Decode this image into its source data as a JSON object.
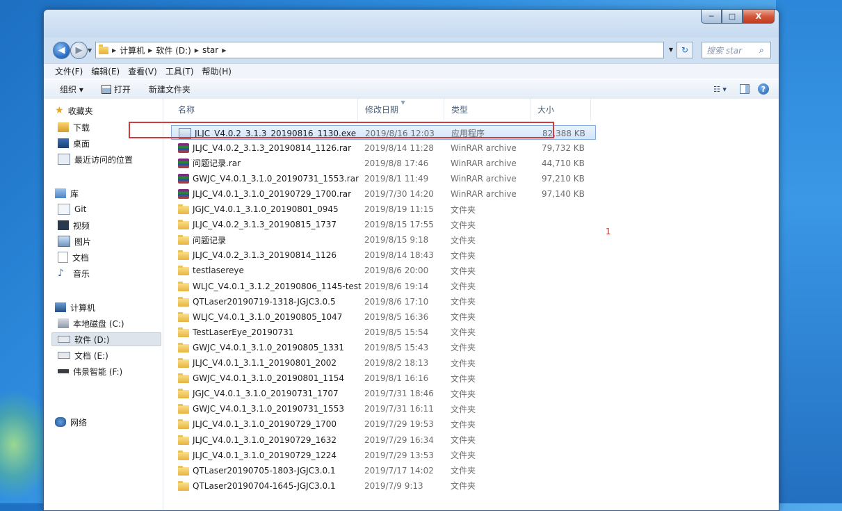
{
  "window": {
    "caption": {
      "minimize": "─",
      "maximize": "□",
      "close": "X"
    }
  },
  "address": {
    "back_icon": "back-arrow-icon",
    "forward_icon": "forward-arrow-icon",
    "crumbs": [
      "计算机",
      "软件 (D:)",
      "star"
    ],
    "search_placeholder": "搜索 star"
  },
  "menu": [
    "文件(F)",
    "编辑(E)",
    "查看(V)",
    "工具(T)",
    "帮助(H)"
  ],
  "toolbar": {
    "organize": "组织 ▾",
    "open": "打开",
    "new_folder": "新建文件夹"
  },
  "sidebar": {
    "favorites": {
      "header": "收藏夹",
      "items": [
        "下载",
        "桌面",
        "最近访问的位置"
      ]
    },
    "libraries": {
      "header": "库",
      "items": [
        "Git",
        "视频",
        "图片",
        "文档",
        "音乐"
      ]
    },
    "computer": {
      "header": "计算机",
      "items": [
        "本地磁盘 (C:)",
        "软件 (D:)",
        "文档 (E:)",
        "伟景智能 (F:)"
      ],
      "selected": "软件 (D:)"
    },
    "network": {
      "header": "网络"
    }
  },
  "columns": {
    "name": "名称",
    "date": "修改日期",
    "type": "类型",
    "size": "大小"
  },
  "files": [
    {
      "kind": "exe",
      "name": "JLJC_V4.0.2_3.1.3_20190816_1130.exe",
      "date": "2019/8/16 12:03",
      "type": "应用程序",
      "size": "82,388 KB"
    },
    {
      "kind": "rar",
      "name": "JLJC_V4.0.2_3.1.3_20190814_1126.rar",
      "date": "2019/8/14 11:28",
      "type": "WinRAR archive",
      "size": "79,732 KB"
    },
    {
      "kind": "rar",
      "name": "问题记录.rar",
      "date": "2019/8/8 17:46",
      "type": "WinRAR archive",
      "size": "44,710 KB"
    },
    {
      "kind": "rar",
      "name": "GWJC_V4.0.1_3.1.0_20190731_1553.rar",
      "date": "2019/8/1 11:49",
      "type": "WinRAR archive",
      "size": "97,210 KB"
    },
    {
      "kind": "rar",
      "name": "JLJC_V4.0.1_3.1.0_20190729_1700.rar",
      "date": "2019/7/30 14:20",
      "type": "WinRAR archive",
      "size": "97,140 KB"
    },
    {
      "kind": "folder",
      "name": "JGJC_V4.0.1_3.1.0_20190801_0945",
      "date": "2019/8/19 11:15",
      "type": "文件夹",
      "size": ""
    },
    {
      "kind": "folder",
      "name": "JLJC_V4.0.2_3.1.3_20190815_1737",
      "date": "2019/8/15 17:55",
      "type": "文件夹",
      "size": ""
    },
    {
      "kind": "folder",
      "name": "问题记录",
      "date": "2019/8/15 9:18",
      "type": "文件夹",
      "size": ""
    },
    {
      "kind": "folder",
      "name": "JLJC_V4.0.2_3.1.3_20190814_1126",
      "date": "2019/8/14 18:43",
      "type": "文件夹",
      "size": ""
    },
    {
      "kind": "folder",
      "name": "testlasereye",
      "date": "2019/8/6 20:00",
      "type": "文件夹",
      "size": ""
    },
    {
      "kind": "folder",
      "name": "WLJC_V4.0.1_3.1.2_20190806_1145-test",
      "date": "2019/8/6 19:14",
      "type": "文件夹",
      "size": ""
    },
    {
      "kind": "folder",
      "name": "QTLaser20190719-1318-JGJC3.0.5",
      "date": "2019/8/6 17:10",
      "type": "文件夹",
      "size": ""
    },
    {
      "kind": "folder",
      "name": "WLJC_V4.0.1_3.1.0_20190805_1047",
      "date": "2019/8/5 16:36",
      "type": "文件夹",
      "size": ""
    },
    {
      "kind": "folder",
      "name": "TestLaserEye_20190731",
      "date": "2019/8/5 15:54",
      "type": "文件夹",
      "size": ""
    },
    {
      "kind": "folder",
      "name": "GWJC_V4.0.1_3.1.0_20190805_1331",
      "date": "2019/8/5 15:43",
      "type": "文件夹",
      "size": ""
    },
    {
      "kind": "folder",
      "name": "JLJC_V4.0.1_3.1.1_20190801_2002",
      "date": "2019/8/2 18:13",
      "type": "文件夹",
      "size": ""
    },
    {
      "kind": "folder",
      "name": "GWJC_V4.0.1_3.1.0_20190801_1154",
      "date": "2019/8/1 16:16",
      "type": "文件夹",
      "size": ""
    },
    {
      "kind": "folder",
      "name": "JGJC_V4.0.1_3.1.0_20190731_1707",
      "date": "2019/7/31 18:46",
      "type": "文件夹",
      "size": ""
    },
    {
      "kind": "folder",
      "name": "GWJC_V4.0.1_3.1.0_20190731_1553",
      "date": "2019/7/31 16:11",
      "type": "文件夹",
      "size": ""
    },
    {
      "kind": "folder",
      "name": "JLJC_V4.0.1_3.1.0_20190729_1700",
      "date": "2019/7/29 19:53",
      "type": "文件夹",
      "size": ""
    },
    {
      "kind": "folder",
      "name": "JLJC_V4.0.1_3.1.0_20190729_1632",
      "date": "2019/7/29 16:34",
      "type": "文件夹",
      "size": ""
    },
    {
      "kind": "folder",
      "name": "JLJC_V4.0.1_3.1.0_20190729_1224",
      "date": "2019/7/29 13:53",
      "type": "文件夹",
      "size": ""
    },
    {
      "kind": "folder",
      "name": "QTLaser20190705-1803-JGJC3.0.1",
      "date": "2019/7/17 14:02",
      "type": "文件夹",
      "size": ""
    },
    {
      "kind": "folder",
      "name": "QTLaser20190704-1645-JGJC3.0.1",
      "date": "2019/7/9 9:13",
      "type": "文件夹",
      "size": ""
    }
  ],
  "selected_file_index": 0,
  "annotation_marker": "1",
  "colors": {
    "selection_border": "#84acdd",
    "highlight_box": "#d23b3b",
    "desktop": "#2f8ee0"
  }
}
